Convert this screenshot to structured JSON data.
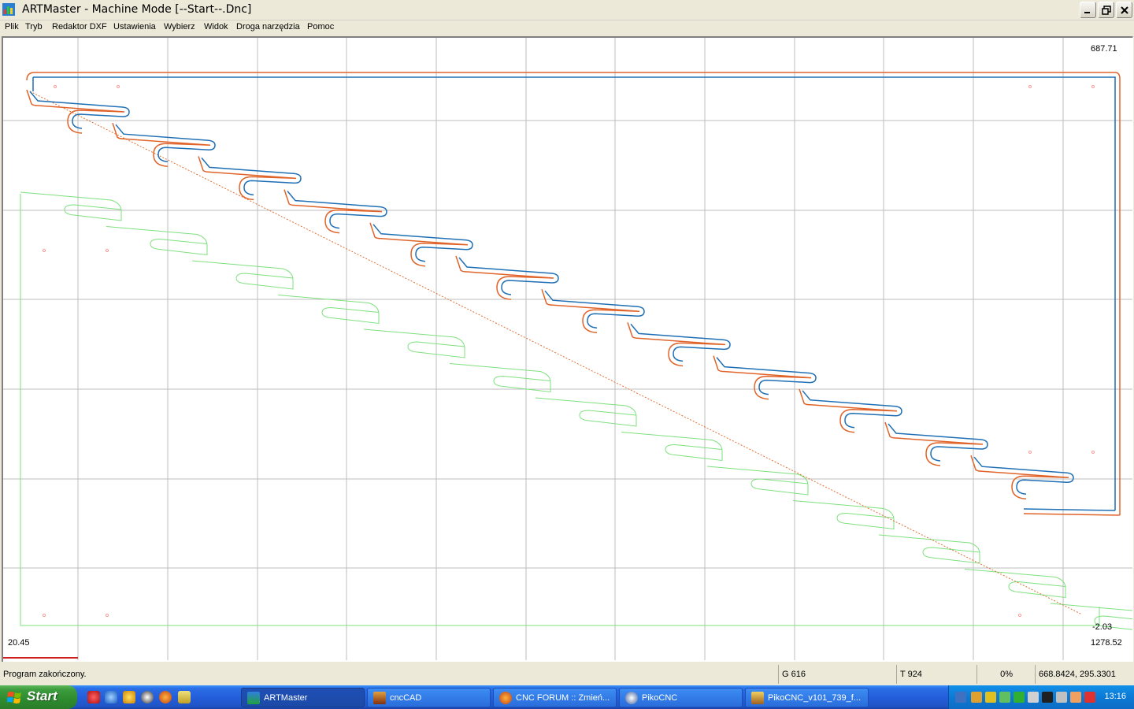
{
  "window": {
    "title": "ARTMaster - Machine Mode [--Start--.Dnc]",
    "buttons": [
      "minimize",
      "restore",
      "close"
    ]
  },
  "menu": [
    {
      "label": "Plik"
    },
    {
      "label": "Tryb"
    },
    {
      "label": "Redaktor DXF"
    },
    {
      "label": "Ustawienia"
    },
    {
      "label": "Wybierz"
    },
    {
      "label": "Widok"
    },
    {
      "label": "Droga narzędzia"
    },
    {
      "label": "Pomoc"
    }
  ],
  "canvas": {
    "top_right_value": "687.71",
    "right_low_value": "-2.03",
    "bottom_left_value": "20.45",
    "bottom_right_value": "1278.52",
    "colors": {
      "toolpath_blue": "#1f6fb5",
      "toolpath_orange": "#e0642a",
      "original_green": "#7ee07e",
      "grid": "#bdbdbd",
      "rapid_dotted": "#e07030"
    }
  },
  "status": {
    "message": "Program zakończony.",
    "g_value": "G 616",
    "t_value": "T 924",
    "percent": "0%",
    "coords": "668.8424, 295.3301"
  },
  "taskbar": {
    "start_label": "Start",
    "quick_launch": [
      "opera-icon",
      "ie-icon",
      "winamp-icon",
      "media-player-icon",
      "firefox-icon",
      "picture-icon"
    ],
    "tasks": [
      {
        "label": "ARTMaster",
        "icon": "artmaster-icon",
        "active": true
      },
      {
        "label": "cncCAD",
        "icon": "cnccad-icon",
        "active": false
      },
      {
        "label": "CNC FORUM :: Zmień...",
        "icon": "firefox-icon",
        "active": false
      },
      {
        "label": "PikoCNC",
        "icon": "pikocnc-icon",
        "active": false
      },
      {
        "label": "PikoCNC_v101_739_f...",
        "icon": "archive-icon",
        "active": false
      }
    ],
    "clock": "13:16"
  }
}
